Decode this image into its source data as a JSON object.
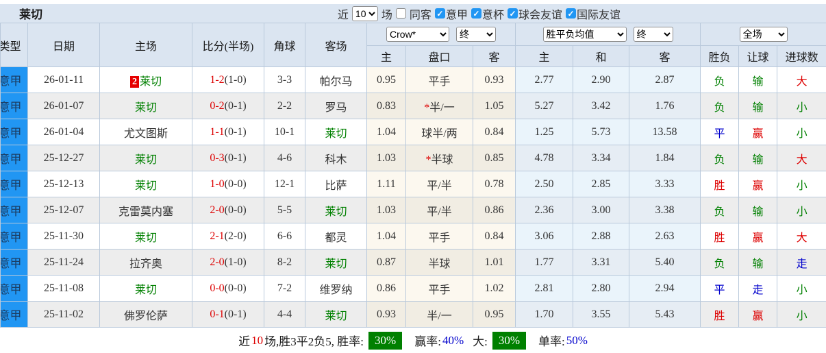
{
  "topbar": {
    "title": "莱切",
    "near_label": "近",
    "matches_count": "10",
    "matches_label": "场",
    "same_away": {
      "label": "同客",
      "checked": false
    },
    "filters": [
      {
        "label": "意甲",
        "checked": true
      },
      {
        "label": "意杯",
        "checked": true
      },
      {
        "label": "球会友谊",
        "checked": true
      },
      {
        "label": "国际友谊",
        "checked": true
      }
    ]
  },
  "table": {
    "left_headers": [
      "类型",
      "日期",
      "主场",
      "比分(半场)",
      "角球",
      "客场"
    ],
    "odds_source_select": "Crow*",
    "odds_time_select": "终",
    "avg_select": "胜平负均值",
    "avg_time_select": "终",
    "scope_select": "全场",
    "sub_headers": [
      "主",
      "盘口",
      "客",
      "主",
      "和",
      "客",
      "胜负",
      "让球",
      "进球数"
    ],
    "rows": [
      {
        "league": "意甲",
        "date": "26-01-11",
        "home": "莱切",
        "home_badge": "2",
        "home_lecce": true,
        "score": "1-2",
        "half": "(1-0)",
        "corner": "3-3",
        "away": "帕尔马",
        "away_lecce": false,
        "o1": "0.95",
        "hstar": false,
        "hcap": "平手",
        "o2": "0.93",
        "a1": "2.77",
        "a2": "2.90",
        "a3": "2.87",
        "res": "负",
        "res_c": "green",
        "sp": "输",
        "sp_c": "green",
        "gl": "大",
        "gl_c": "red"
      },
      {
        "league": "意甲",
        "date": "26-01-07",
        "home": "莱切",
        "home_badge": "",
        "home_lecce": true,
        "score": "0-2",
        "half": "(0-1)",
        "corner": "2-2",
        "away": "罗马",
        "away_lecce": false,
        "o1": "0.83",
        "hstar": true,
        "hcap": "半/一",
        "o2": "1.05",
        "a1": "5.27",
        "a2": "3.42",
        "a3": "1.76",
        "res": "负",
        "res_c": "green",
        "sp": "输",
        "sp_c": "green",
        "gl": "小",
        "gl_c": "green"
      },
      {
        "league": "意甲",
        "date": "26-01-04",
        "home": "尤文图斯",
        "home_badge": "",
        "home_lecce": false,
        "score": "1-1",
        "half": "(0-1)",
        "corner": "10-1",
        "away": "莱切",
        "away_lecce": true,
        "o1": "1.04",
        "hstar": false,
        "hcap": "球半/两",
        "o2": "0.84",
        "a1": "1.25",
        "a2": "5.73",
        "a3": "13.58",
        "res": "平",
        "res_c": "blue",
        "sp": "赢",
        "sp_c": "red",
        "gl": "小",
        "gl_c": "green"
      },
      {
        "league": "意甲",
        "date": "25-12-27",
        "home": "莱切",
        "home_badge": "",
        "home_lecce": true,
        "score": "0-3",
        "half": "(0-1)",
        "corner": "4-6",
        "away": "科木",
        "away_lecce": false,
        "o1": "1.03",
        "hstar": true,
        "hcap": "半球",
        "o2": "0.85",
        "a1": "4.78",
        "a2": "3.34",
        "a3": "1.84",
        "res": "负",
        "res_c": "green",
        "sp": "输",
        "sp_c": "green",
        "gl": "大",
        "gl_c": "red"
      },
      {
        "league": "意甲",
        "date": "25-12-13",
        "home": "莱切",
        "home_badge": "",
        "home_lecce": true,
        "score": "1-0",
        "half": "(0-0)",
        "corner": "12-1",
        "away": "比萨",
        "away_lecce": false,
        "o1": "1.11",
        "hstar": false,
        "hcap": "平/半",
        "o2": "0.78",
        "a1": "2.50",
        "a2": "2.85",
        "a3": "3.33",
        "res": "胜",
        "res_c": "red",
        "sp": "赢",
        "sp_c": "red",
        "gl": "小",
        "gl_c": "green"
      },
      {
        "league": "意甲",
        "date": "25-12-07",
        "home": "克雷莫内塞",
        "home_badge": "",
        "home_lecce": false,
        "score": "2-0",
        "half": "(0-0)",
        "corner": "5-5",
        "away": "莱切",
        "away_lecce": true,
        "o1": "1.03",
        "hstar": false,
        "hcap": "平/半",
        "o2": "0.86",
        "a1": "2.36",
        "a2": "3.00",
        "a3": "3.38",
        "res": "负",
        "res_c": "green",
        "sp": "输",
        "sp_c": "green",
        "gl": "小",
        "gl_c": "green"
      },
      {
        "league": "意甲",
        "date": "25-11-30",
        "home": "莱切",
        "home_badge": "",
        "home_lecce": true,
        "score": "2-1",
        "half": "(2-0)",
        "corner": "6-6",
        "away": "都灵",
        "away_lecce": false,
        "o1": "1.04",
        "hstar": false,
        "hcap": "平手",
        "o2": "0.84",
        "a1": "3.06",
        "a2": "2.88",
        "a3": "2.63",
        "res": "胜",
        "res_c": "red",
        "sp": "赢",
        "sp_c": "red",
        "gl": "大",
        "gl_c": "red"
      },
      {
        "league": "意甲",
        "date": "25-11-24",
        "home": "拉齐奥",
        "home_badge": "",
        "home_lecce": false,
        "score": "2-0",
        "half": "(1-0)",
        "corner": "8-2",
        "away": "莱切",
        "away_lecce": true,
        "o1": "0.87",
        "hstar": false,
        "hcap": "半球",
        "o2": "1.01",
        "a1": "1.77",
        "a2": "3.31",
        "a3": "5.40",
        "res": "负",
        "res_c": "green",
        "sp": "输",
        "sp_c": "green",
        "gl": "走",
        "gl_c": "blue"
      },
      {
        "league": "意甲",
        "date": "25-11-08",
        "home": "莱切",
        "home_badge": "",
        "home_lecce": true,
        "score": "0-0",
        "half": "(0-0)",
        "corner": "7-2",
        "away": "维罗纳",
        "away_lecce": false,
        "o1": "0.86",
        "hstar": false,
        "hcap": "平手",
        "o2": "1.02",
        "a1": "2.81",
        "a2": "2.80",
        "a3": "2.94",
        "res": "平",
        "res_c": "blue",
        "sp": "走",
        "sp_c": "blue",
        "gl": "小",
        "gl_c": "green"
      },
      {
        "league": "意甲",
        "date": "25-11-02",
        "home": "佛罗伦萨",
        "home_badge": "",
        "home_lecce": false,
        "score": "0-1",
        "half": "(0-1)",
        "corner": "4-4",
        "away": "莱切",
        "away_lecce": true,
        "o1": "0.93",
        "hstar": false,
        "hcap": "半/一",
        "o2": "0.95",
        "a1": "1.70",
        "a2": "3.55",
        "a3": "5.43",
        "res": "胜",
        "res_c": "red",
        "sp": "赢",
        "sp_c": "red",
        "gl": "小",
        "gl_c": "green"
      }
    ]
  },
  "summary": {
    "prefix": "近",
    "count": "10",
    "stats": "场,胜3平2负5, 胜率:",
    "win_rate_box": "30%",
    "profit_label": "赢率:",
    "profit_value": "40%",
    "big_label": "大:",
    "big_rate_box": "30%",
    "single_label": "单率:",
    "single_value": "50%"
  },
  "colors": {
    "league_bg": "#2196f3",
    "checkbox_blue": "#2196f3",
    "win_red": "#dd0000",
    "draw_blue": "#0000cc",
    "lose_green": "#008000",
    "badge_bg": "#e60000",
    "rate_box_bg": "#008000",
    "header_bg": "#dbe5f1"
  }
}
